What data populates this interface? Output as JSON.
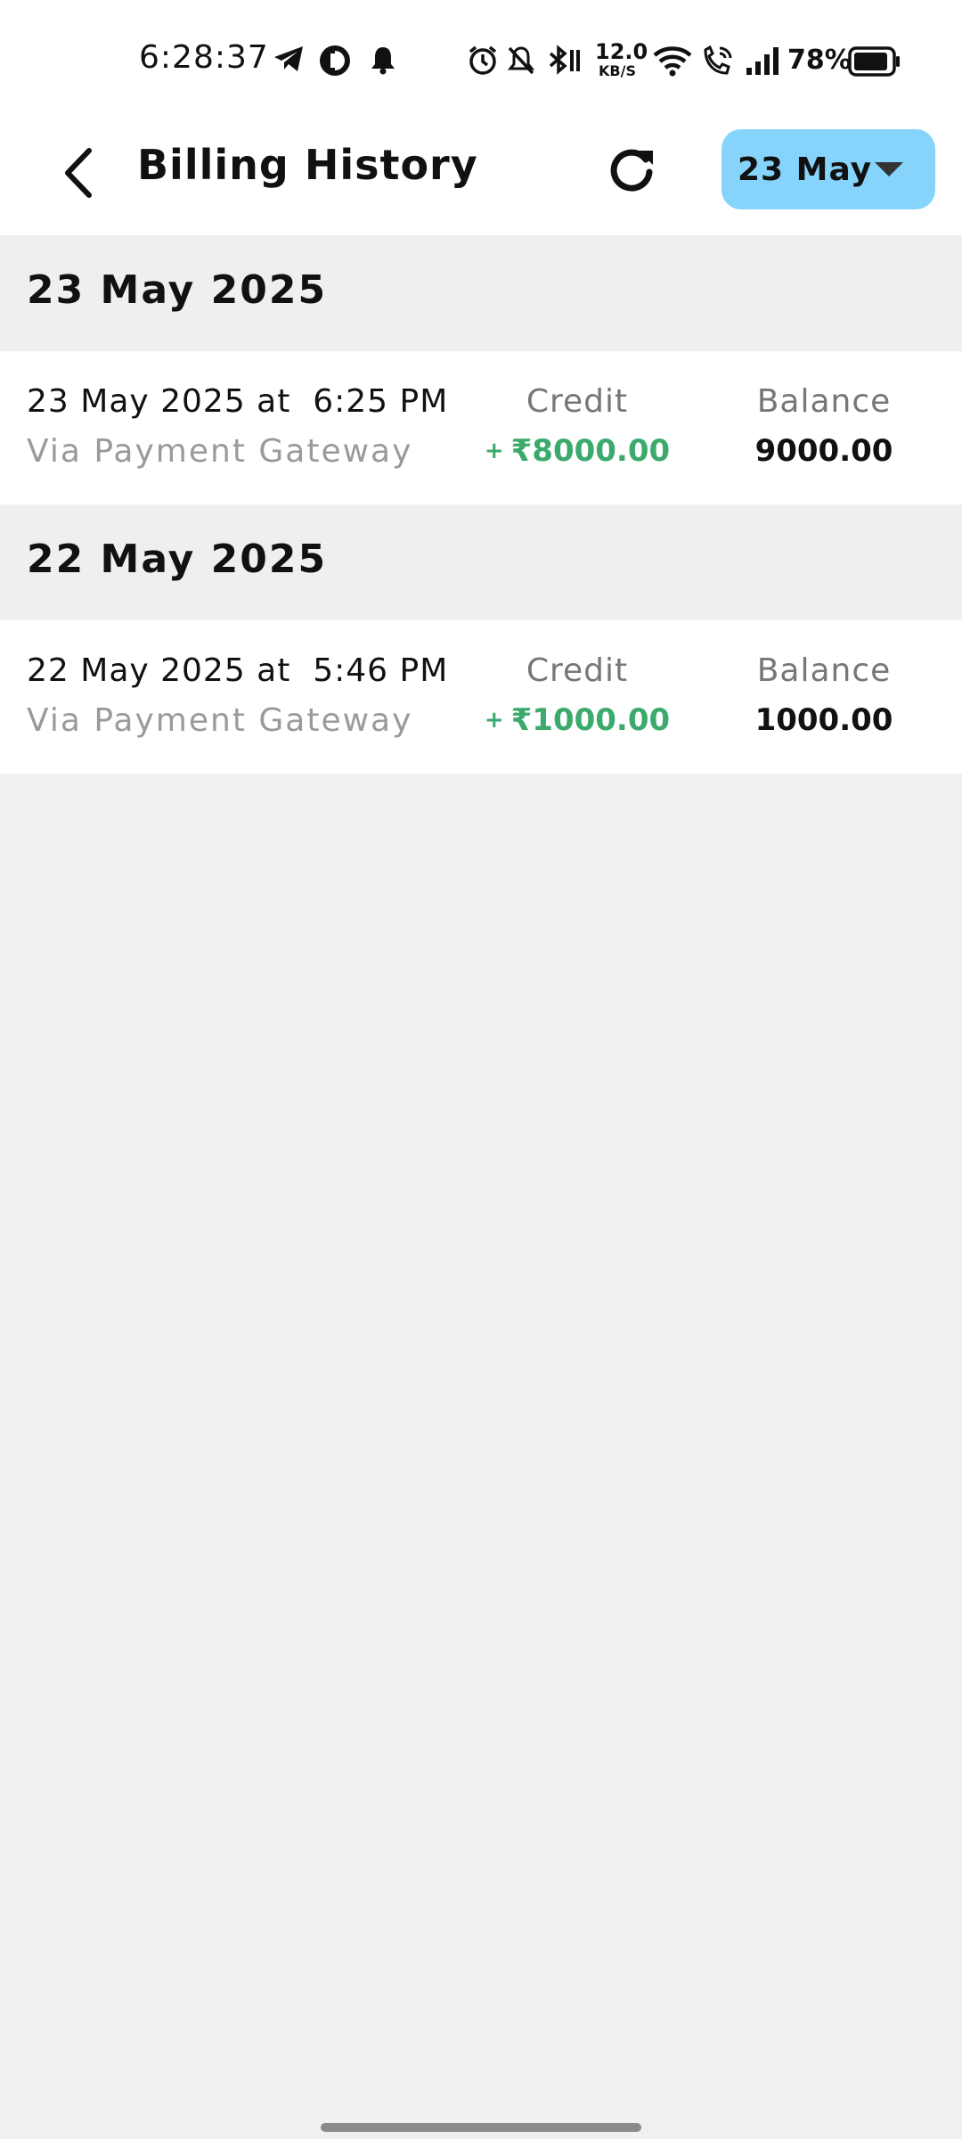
{
  "status_bar": {
    "time": "6:28:37",
    "network_speed_value": "12.0",
    "network_speed_unit": "KB/S",
    "battery_percent": "78%",
    "icons": [
      "telegram-icon",
      "app-notification-icon",
      "bell-icon",
      "alarm-icon",
      "mute-icon",
      "bluetooth-icon",
      "wifi-icon",
      "wifi-calling-icon",
      "signal-icon",
      "battery-icon"
    ]
  },
  "header": {
    "title": "Billing History",
    "date_filter_label": "23 May"
  },
  "groups": [
    {
      "date_label": "23 May 2025",
      "transactions": [
        {
          "datetime": "23 May 2025 at  6:25 PM",
          "method": "Via Payment Gateway",
          "credit_label": "Credit",
          "credit_sign": "+",
          "credit_amount": "₹8000.00",
          "balance_label": "Balance",
          "balance_value": "9000.00"
        }
      ]
    },
    {
      "date_label": "22 May 2025",
      "transactions": [
        {
          "datetime": "22 May 2025 at  5:46 PM",
          "method": "Via Payment Gateway",
          "credit_label": "Credit",
          "credit_sign": "+",
          "credit_amount": "₹1000.00",
          "balance_label": "Balance",
          "balance_value": "1000.00"
        }
      ]
    }
  ],
  "colors": {
    "accent_dropdown": "#86d3fb",
    "credit_green": "#3caa6c",
    "muted_text": "#9a9a9a",
    "background": "#f0f0f0"
  }
}
